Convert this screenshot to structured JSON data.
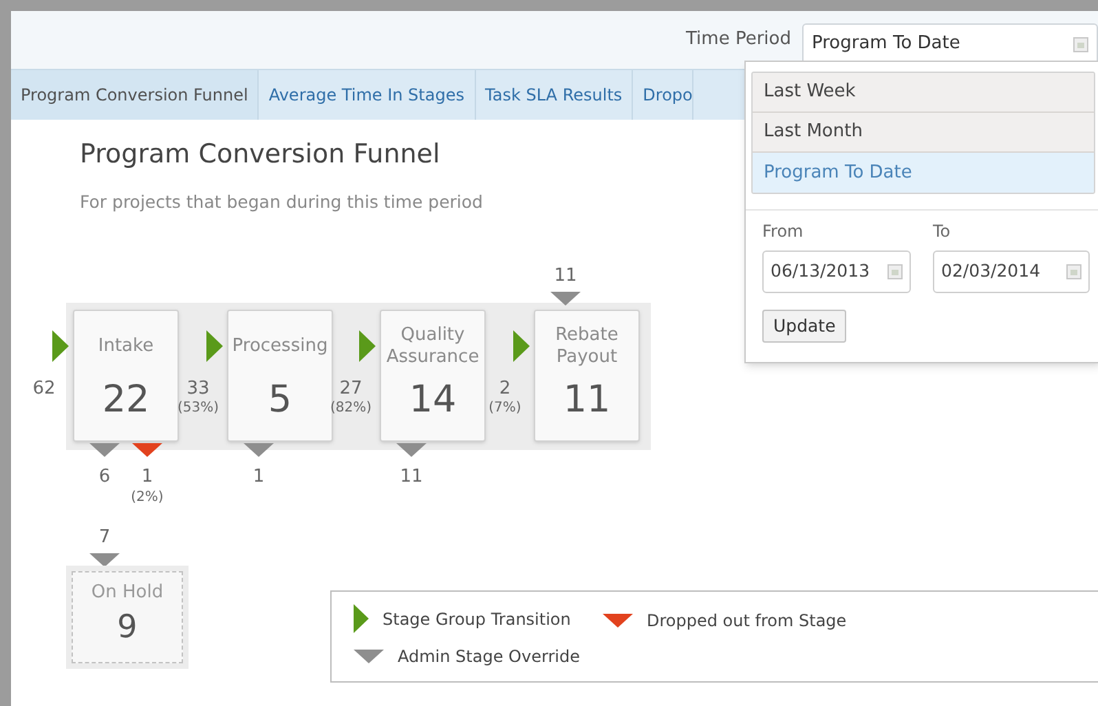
{
  "header": {
    "time_period_label": "Time Period",
    "time_period_value": "Program To Date"
  },
  "tabs": [
    {
      "label": "Program Conversion Funnel",
      "selected": true
    },
    {
      "label": "Average Time In Stages",
      "selected": false
    },
    {
      "label": "Task SLA Results",
      "selected": false
    },
    {
      "label": "Dropo",
      "selected": false
    }
  ],
  "dropdown": {
    "options": [
      {
        "label": "Last Week",
        "selected": false
      },
      {
        "label": "Last Month",
        "selected": false
      },
      {
        "label": "Program To Date",
        "selected": true
      }
    ],
    "from_label": "From",
    "from_value": "06/13/2013",
    "to_label": "To",
    "to_value": "02/03/2014",
    "update_button": "Update"
  },
  "title": "Program Conversion Funnel",
  "subtitle": "For projects that began during this time period",
  "funnel": {
    "stages": [
      {
        "name": "Intake",
        "count": "22",
        "entry": {
          "count": "62"
        },
        "bottom": [
          {
            "kind": "override",
            "count": "6"
          },
          {
            "kind": "dropped",
            "count": "1",
            "percent": "(2%)"
          }
        ]
      },
      {
        "name": "Processing",
        "count": "5",
        "entry": {
          "count": "33",
          "percent": "(53%)"
        },
        "bottom": [
          {
            "kind": "override",
            "count": "1"
          }
        ]
      },
      {
        "name": "Quality Assurance",
        "count": "14",
        "entry": {
          "count": "27",
          "percent": "(82%)"
        },
        "bottom": [
          {
            "kind": "override",
            "count": "11"
          }
        ]
      },
      {
        "name": "Rebate Payout",
        "count": "11",
        "entry": {
          "count": "2",
          "percent": "(7%)"
        },
        "top": {
          "kind": "override",
          "count": "11"
        }
      }
    ],
    "hold": {
      "name": "On Hold",
      "count": "9",
      "top": {
        "kind": "override",
        "count": "7"
      }
    }
  },
  "legend": [
    {
      "kind": "transition",
      "label": "Stage Group Transition"
    },
    {
      "kind": "dropped",
      "label": "Dropped out from Stage"
    },
    {
      "kind": "override",
      "label": "Admin Stage Override"
    }
  ]
}
